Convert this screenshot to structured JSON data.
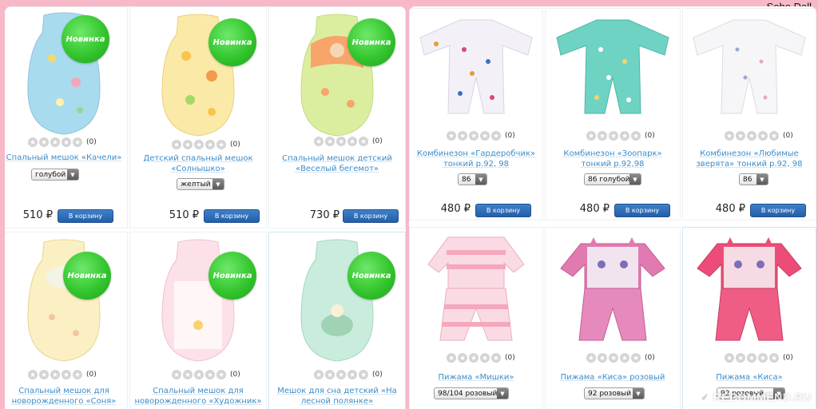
{
  "brand": "Soho Doll",
  "watermark": "RECOMMEND.RU",
  "colors": {
    "background": "#f7b8c8",
    "link": "#3c8cc9",
    "badge": "#34c62e",
    "cart_button": "#2f6fb8"
  },
  "badge_label": "Новинка",
  "cart_label": "В корзину",
  "left_products": [
    {
      "title": "Спальный мешок «Качели»",
      "rating_count": "(0)",
      "select": "голубой",
      "price": "510 ₽",
      "badge": true
    },
    {
      "title": "Детский спальный мешок\n«Солнышко»",
      "rating_count": "(0)",
      "select": "желтый",
      "price": "510 ₽",
      "badge": true
    },
    {
      "title": "Спальный мешок детский\n«Веселый бегемот»",
      "rating_count": "(0)",
      "select": "",
      "price": "730 ₽",
      "badge": true
    },
    {
      "title": "Спальный мешок для\nноворожденного «Соня»",
      "rating_count": "(0)",
      "select": "",
      "price": "",
      "badge": true
    },
    {
      "title": "Спальный мешок для\nноворожденного «Художник»",
      "rating_count": "(0)",
      "select": "",
      "price": "",
      "badge": true
    },
    {
      "title": "Мешок для сна детский «На\nлесной полянке»",
      "rating_count": "(0)",
      "select": "",
      "price": "",
      "badge": true
    }
  ],
  "right_products": [
    {
      "title": "Комбинезон «Гардеробчик»\nтонкий р.92, 98",
      "rating_count": "(0)",
      "select": "86",
      "price": "480 ₽"
    },
    {
      "title": "Комбинезон «Зоопарк»\nтонкий р.92,98",
      "rating_count": "(0)",
      "select": "86 голубой",
      "price": "480 ₽"
    },
    {
      "title": "Комбинезон «Любимые\nзверята» тонкий р.92, 98",
      "rating_count": "(0)",
      "select": "86",
      "price": "480 ₽"
    },
    {
      "title": "Пижама «Мишки»",
      "rating_count": "(0)",
      "select": "98/104 розовый",
      "price": ""
    },
    {
      "title": "Пижама «Киса» розовый",
      "rating_count": "(0)",
      "select": "92 розовый",
      "price": ""
    },
    {
      "title": "Пижама «Киса»",
      "rating_count": "(0)",
      "select": "92 розовый",
      "price": ""
    }
  ]
}
